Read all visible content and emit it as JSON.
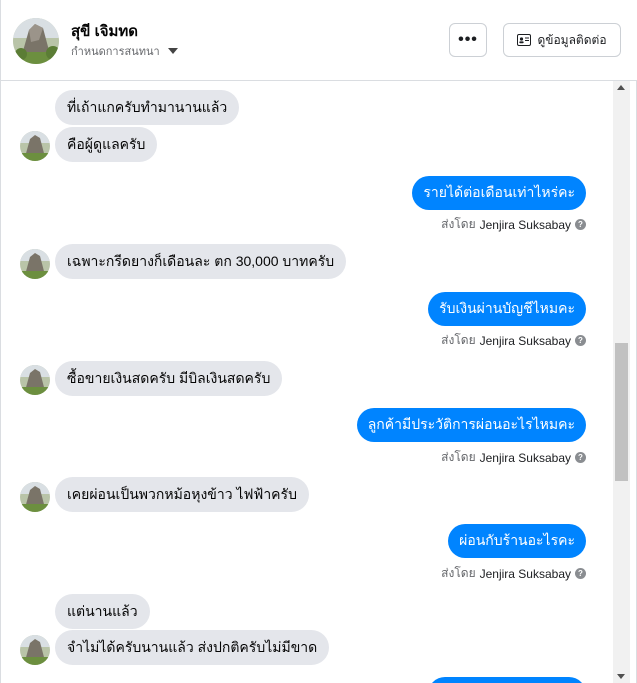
{
  "header": {
    "name": "สุขี เจิมทด",
    "subtitle": "กำหนดการสนทนา",
    "more_label": "•••",
    "contact_label": "ดูข้อมูลติดต่อ",
    "contact_icon": "id-card-icon"
  },
  "messages": {
    "m1": "ที่เถ้าแกครับทำมานานแล้ว",
    "m2": "คือผู้ดูแลครับ",
    "m3": "รายได้ต่อเดือนเท่าไหร่คะ",
    "m4": "เฉพาะกรีดยางก็เดือนละ ตก 30,000 บาทครับ",
    "m5": "รับเงินผ่านบัญชีไหมคะ",
    "m6": "ซื้อขายเงินสดครับ มีบิลเงินสดครับ",
    "m7": "ลูกค้ามีประวัติการผ่อนอะไรไหมคะ",
    "m8": "เคยผ่อนเป็นพวกหม้อหุงข้าว ไฟฟ้าครับ",
    "m9": "ผ่อนกับร้านอะไรคะ",
    "m10": "แต่นานแล้ว",
    "m11": "จำไม่ได้ครับนานแล้ว ส่งปกติครับไม่มีขาด"
  },
  "sent_by": {
    "prefix": "ส่งโดย",
    "name": "Jenjira Suksabay",
    "help_icon": "?"
  },
  "colors": {
    "outgoing_bubble": "#0084ff",
    "incoming_bubble": "#e4e6eb",
    "secondary_text": "#65676b"
  }
}
